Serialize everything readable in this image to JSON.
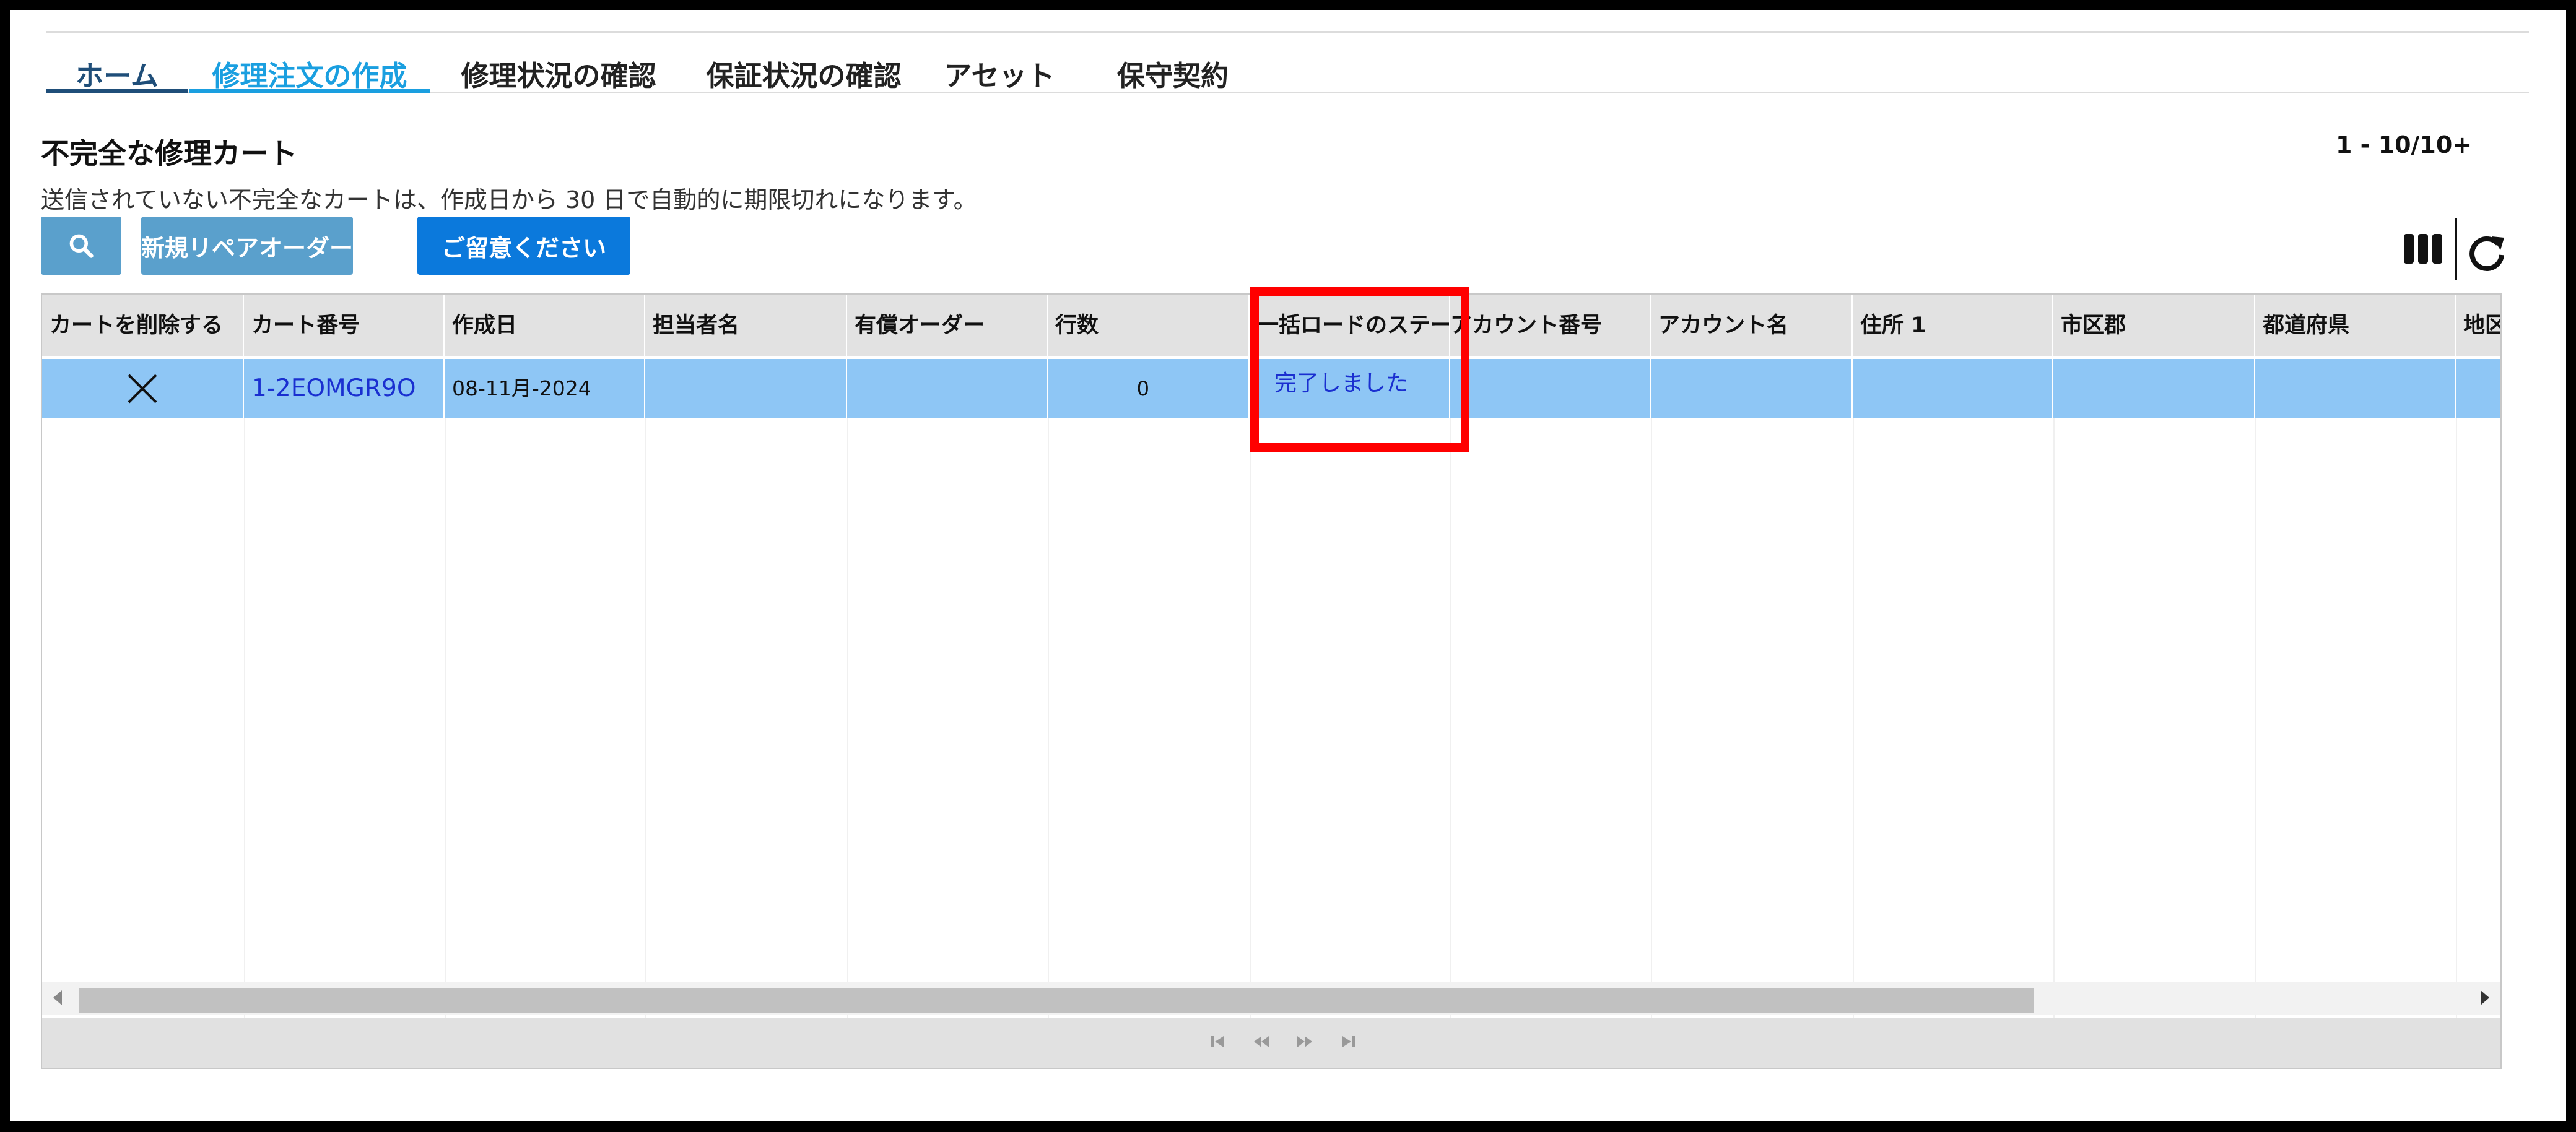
{
  "nav": {
    "tabs": [
      {
        "label": "ホーム"
      },
      {
        "label": "修理注文の作成"
      },
      {
        "label": "修理状況の確認"
      },
      {
        "label": "保証状況の確認"
      },
      {
        "label": "アセット"
      },
      {
        "label": "保守契約"
      }
    ],
    "active_tab": "修理注文の作成"
  },
  "section": {
    "title": "不完全な修理カート",
    "description": "送信されていない不完全なカートは、作成日から 30 日で自動的に期限切れになります。",
    "pager": "1 - 10/10+"
  },
  "toolbar": {
    "search_icon": "search-icon",
    "new_repair_order": "新規リペアオーダー",
    "notice": "ご留意ください",
    "columns_icon": "columns-icon",
    "refresh_icon": "refresh-icon"
  },
  "table": {
    "columns": [
      "カートを削除する",
      "カート番号",
      "作成日",
      "担当者名",
      "有償オーダー",
      "行数",
      "一括ロードのステー",
      "アカウント番号",
      "アカウント名",
      "住所 1",
      "市区郡",
      "都道府県",
      "地区"
    ],
    "rows": [
      {
        "delete_icon": "close-icon",
        "cart_number": "1-2EOMGR9O",
        "created": "08-11月-2024",
        "owner": "",
        "paid_order": "",
        "lines": "0",
        "bulk_status": "完了しました",
        "account_number": "",
        "account_name": "",
        "address1": "",
        "city": "",
        "prefecture": "",
        "district": ""
      }
    ]
  },
  "colors": {
    "active_tab": "#1a9fe0",
    "home_tab": "#1f4e79",
    "selected_row": "#8ec6f5",
    "highlight": "#ff0000",
    "primary_button": "#0b79dc",
    "secondary_button": "#5aa0cc"
  }
}
